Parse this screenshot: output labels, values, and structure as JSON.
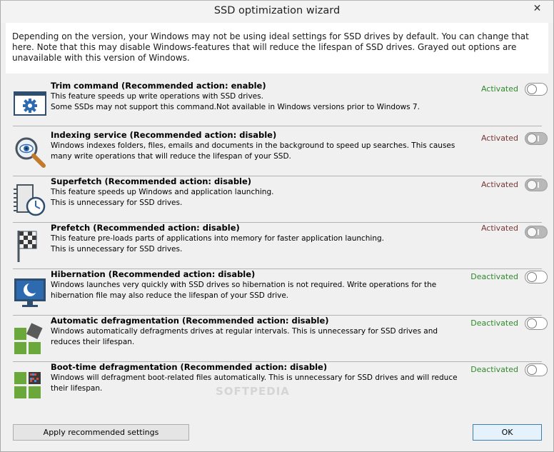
{
  "window": {
    "title": "SSD optimization wizard",
    "close_glyph": "✕"
  },
  "intro": {
    "text": "Depending on the version, your Windows may not be using ideal settings for SSD drives by default. You can change that here. Note that this may disable Windows-features that will reduce the lifespan of SSD drives. Grayed out options are unavailable with this version of Windows."
  },
  "features": [
    {
      "icon": "gear-window-icon",
      "title": "Trim command (Recommended action: enable)",
      "lines": [
        "This feature speeds up write operations with SSD drives.",
        "Some SSDs may not support this command.Not available in Windows versions prior to Windows 7."
      ],
      "status": "Activated",
      "toggle": "on"
    },
    {
      "icon": "magnifier-eye-icon",
      "title": "Indexing service (Recommended action: disable)",
      "lines": [
        "Windows indexes folders, files, emails and documents in the background to speed up searches. This causes",
        "many write operations that will reduce the lifespan of your SSD."
      ],
      "status": "Activated",
      "toggle": "on-grey"
    },
    {
      "icon": "clock-chip-icon",
      "title": "Superfetch (Recommended action: disable)",
      "lines": [
        "This feature speeds up Windows and application launching.",
        "This is unnecessary for SSD drives."
      ],
      "status": "Activated",
      "toggle": "on-grey"
    },
    {
      "icon": "checkered-flag-icon",
      "title": "Prefetch (Recommended action: disable)",
      "lines": [
        "This feature pre-loads parts of applications into memory for faster application launching.",
        "This is unnecessary for SSD drives."
      ],
      "status": "Activated",
      "toggle": "on-grey"
    },
    {
      "icon": "moon-monitor-icon",
      "title": "Hibernation (Recommended action: disable)",
      "lines": [
        "Windows launches very quickly with SSD drives so hibernation is not required. Write operations for the",
        "hibernation file may also reduce the lifespan of your SSD drive."
      ],
      "status": "Deactivated",
      "toggle": "off"
    },
    {
      "icon": "defrag-blocks-icon",
      "title": "Automatic defragmentation (Recommended action: disable)",
      "lines": [
        "Windows automatically defragments drives at regular intervals. This is unnecessary for SSD drives and",
        "reduces their lifespan."
      ],
      "status": "Deactivated",
      "toggle": "off"
    },
    {
      "icon": "defrag-grid-icon",
      "title": "Boot-time defragmentation (Recommended action: disable)",
      "lines": [
        "Windows will defragment boot-related files automatically. This is unnecessary for SSD drives and will reduce",
        "their lifespan."
      ],
      "status": "Deactivated",
      "toggle": "off"
    }
  ],
  "buttons": {
    "apply": "Apply recommended settings",
    "ok": "OK"
  },
  "watermark": "SOFTPEDIA",
  "colors": {
    "activated": "#2f8a2c",
    "activated_grey": "#7a3636",
    "deactivated": "#2f8a2c",
    "toggle_grey": "#b9b9b9"
  }
}
